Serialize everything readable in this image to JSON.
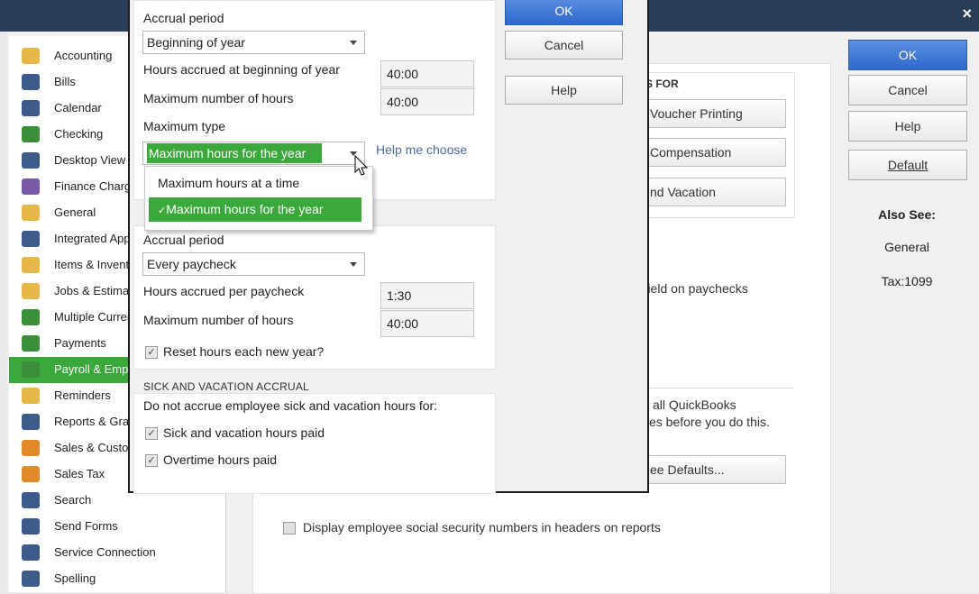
{
  "window": {
    "close_glyph": "×"
  },
  "sidebar": {
    "items": [
      {
        "label": "Accounting",
        "icon": "accounting-icon",
        "color": "#e6b84a"
      },
      {
        "label": "Bills",
        "icon": "bills-icon",
        "color": "#3c5a8a"
      },
      {
        "label": "Calendar",
        "icon": "calendar-icon",
        "color": "#3c5a8a"
      },
      {
        "label": "Checking",
        "icon": "checking-icon",
        "color": "#3b8f3b"
      },
      {
        "label": "Desktop View",
        "icon": "desktop-view-icon",
        "color": "#3c5a8a"
      },
      {
        "label": "Finance Charge",
        "icon": "finance-charge-icon",
        "color": "#7a5aa8"
      },
      {
        "label": "General",
        "icon": "general-icon",
        "color": "#e6b84a"
      },
      {
        "label": "Integrated Applications",
        "icon": "integrated-apps-icon",
        "color": "#3c5a8a"
      },
      {
        "label": "Items & Inventory",
        "icon": "items-inventory-icon",
        "color": "#e6b84a"
      },
      {
        "label": "Jobs & Estimates",
        "icon": "jobs-estimates-icon",
        "color": "#e6b84a"
      },
      {
        "label": "Multiple Currencies",
        "icon": "multiple-currencies-icon",
        "color": "#3b8f3b"
      },
      {
        "label": "Payments",
        "icon": "payments-icon",
        "color": "#3b8f3b"
      },
      {
        "label": "Payroll & Employees",
        "icon": "payroll-icon",
        "color": "#3b8f3b",
        "selected": true
      },
      {
        "label": "Reminders",
        "icon": "reminders-icon",
        "color": "#e6b84a"
      },
      {
        "label": "Reports & Graphs",
        "icon": "reports-graphs-icon",
        "color": "#3c5a8a"
      },
      {
        "label": "Sales & Customers",
        "icon": "sales-customers-icon",
        "color": "#e08a2a"
      },
      {
        "label": "Sales Tax",
        "icon": "sales-tax-icon",
        "color": "#e08a2a"
      },
      {
        "label": "Search",
        "icon": "search-icon",
        "color": "#3c5a8a"
      },
      {
        "label": "Send Forms",
        "icon": "send-forms-icon",
        "color": "#3c5a8a"
      },
      {
        "label": "Service Connection",
        "icon": "service-connection-icon",
        "color": "#3c5a8a"
      },
      {
        "label": "Spelling",
        "icon": "spelling-icon",
        "color": "#3c5a8a"
      }
    ]
  },
  "right_buttons": {
    "ok": "OK",
    "cancel": "Cancel",
    "help": "Help",
    "default": "Default",
    "also_see": "Also See:",
    "link_general": "General",
    "link_tax": "Tax:1099"
  },
  "background": {
    "section_suffix": "S FOR",
    "btn_voucher": "Voucher Printing",
    "btn_compensation": "Compensation",
    "btn_vacation": "nd Vacation",
    "text_field_paychecks": "r field on paychecks",
    "text_quickbooks": "all QuickBooks",
    "text_before": "es before you do this.",
    "btn_defaults": "ee Defaults...",
    "ssn_checkbox_label": "Display employee social security numbers in headers on reports"
  },
  "dialog": {
    "ok": "OK",
    "cancel": "Cancel",
    "help": "Help",
    "sick": {
      "accrual_period_label": "Accrual period",
      "accrual_period_value": "Beginning of year",
      "hours_begin_label": "Hours accrued at beginning of year",
      "hours_begin_value": "40:00",
      "max_hours_label": "Maximum number of hours",
      "max_hours_value": "40:00",
      "max_type_label": "Maximum type",
      "max_type_value": "Maximum hours for the year",
      "help_link": "Help me choose",
      "dropdown_options": [
        "Maximum hours at a time",
        "Maximum hours for the year"
      ],
      "dropdown_selected_index": 1
    },
    "vacation": {
      "accrual_period_label": "Accrual period",
      "accrual_period_value": "Every paycheck",
      "hours_per_paycheck_label": "Hours accrued per paycheck",
      "hours_per_paycheck_value": "1:30",
      "max_hours_label": "Maximum number of hours",
      "max_hours_value": "40:00",
      "reset_label": "Reset hours each new year?",
      "reset_checked": true
    },
    "accrual": {
      "heading": "SICK AND VACATION ACCRUAL",
      "intro": "Do not accrue employee sick and vacation hours for:",
      "opt1": "Sick and vacation hours paid",
      "opt1_checked": true,
      "opt2": "Overtime hours paid",
      "opt2_checked": true
    }
  }
}
